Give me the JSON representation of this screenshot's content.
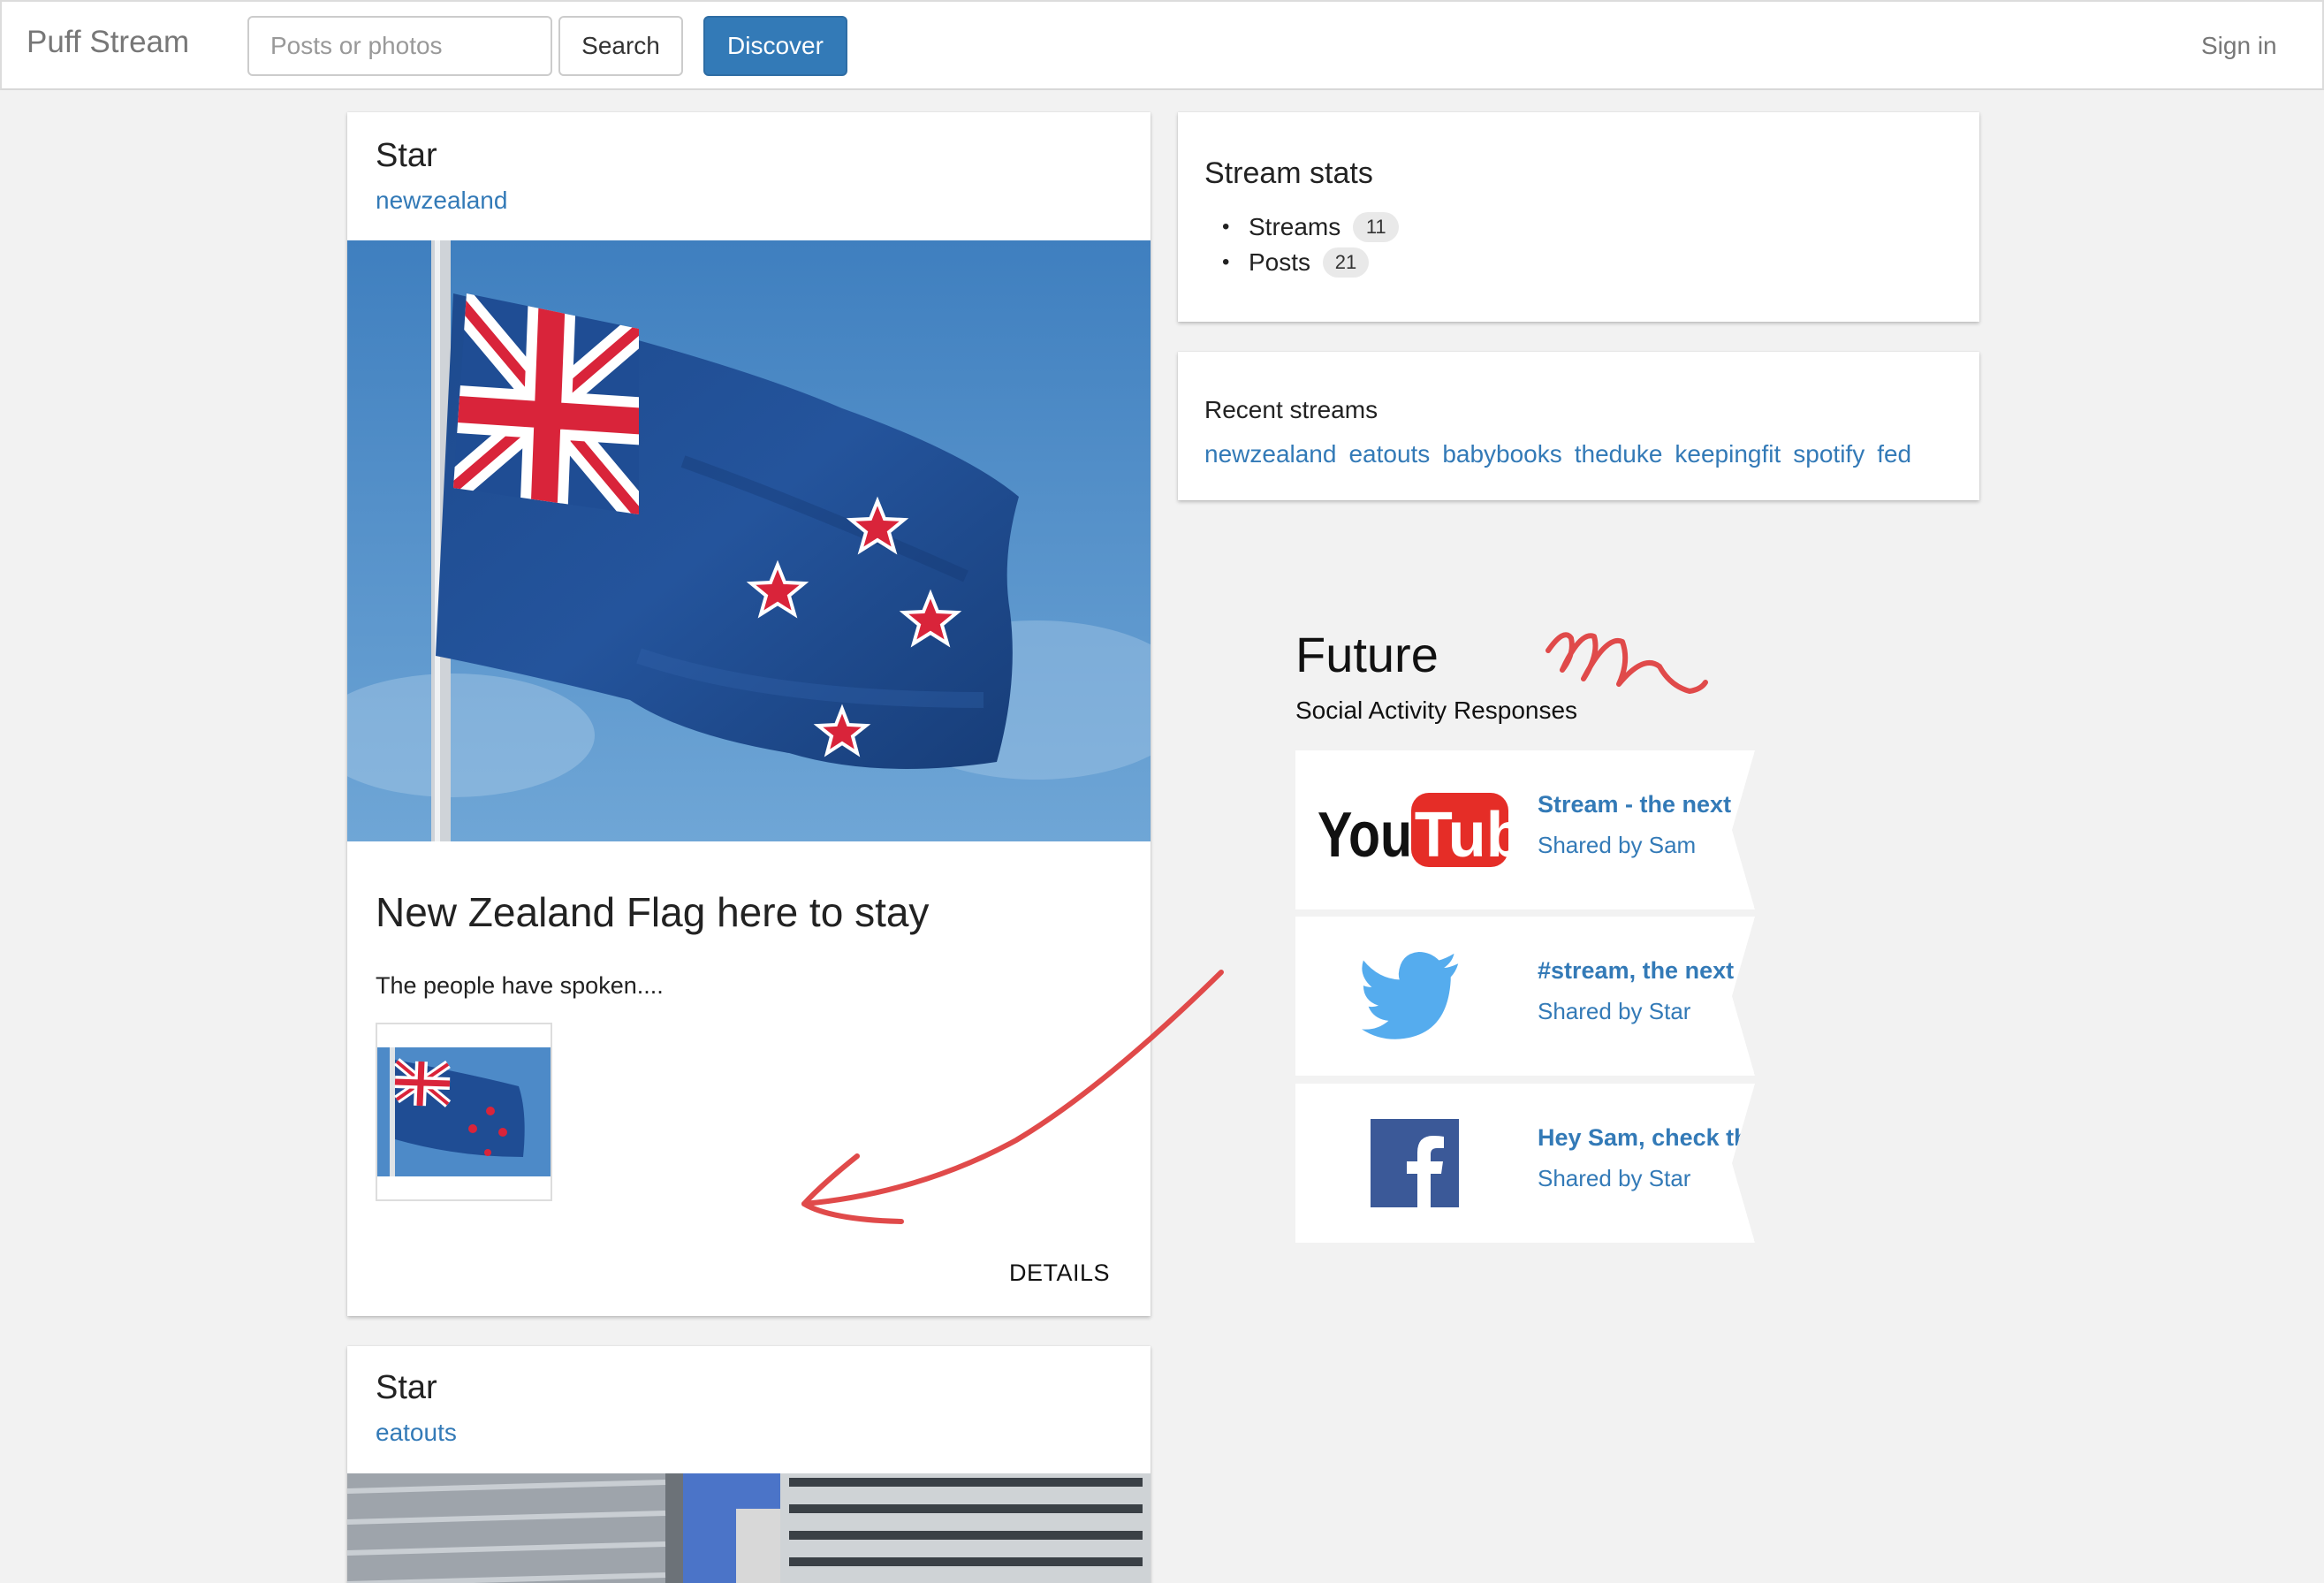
{
  "navbar": {
    "brand": "Puff Stream",
    "search_placeholder": "Posts or photos",
    "search_label": "Search",
    "discover_label": "Discover",
    "signin_label": "Sign in"
  },
  "posts": [
    {
      "author": "Star",
      "stream": "newzealand",
      "title": "New Zealand Flag here to stay",
      "body": "The people have spoken....",
      "details_label": "DETAILS"
    },
    {
      "author": "Star",
      "stream": "eatouts"
    }
  ],
  "stats": {
    "title": "Stream stats",
    "items": [
      {
        "label": "Streams",
        "count": "11"
      },
      {
        "label": "Posts",
        "count": "21"
      }
    ]
  },
  "recent": {
    "title": "Recent streams",
    "links": [
      "newzealand",
      "eatouts",
      "babybooks",
      "theduke",
      "keepingfit",
      "spotify",
      "fed"
    ]
  },
  "future": {
    "title": "Future",
    "subtitle": "Social Activity Responses",
    "items": [
      {
        "network": "youtube",
        "icon": "youtube-logo",
        "title": "Stream - the next",
        "by": "Shared by Sam"
      },
      {
        "network": "twitter",
        "icon": "twitter-bird-icon",
        "title": "#stream, the next big",
        "by": "Shared by Star"
      },
      {
        "network": "facebook",
        "icon": "facebook-icon",
        "title": "Hey Sam, check this",
        "by": "Shared by Star"
      }
    ]
  },
  "colors": {
    "link": "#337ab7",
    "primary_button": "#337ab7",
    "annotation": "#e04a4a",
    "youtube_red": "#e52d27",
    "twitter_blue": "#55acee",
    "facebook_blue": "#3b5998"
  }
}
